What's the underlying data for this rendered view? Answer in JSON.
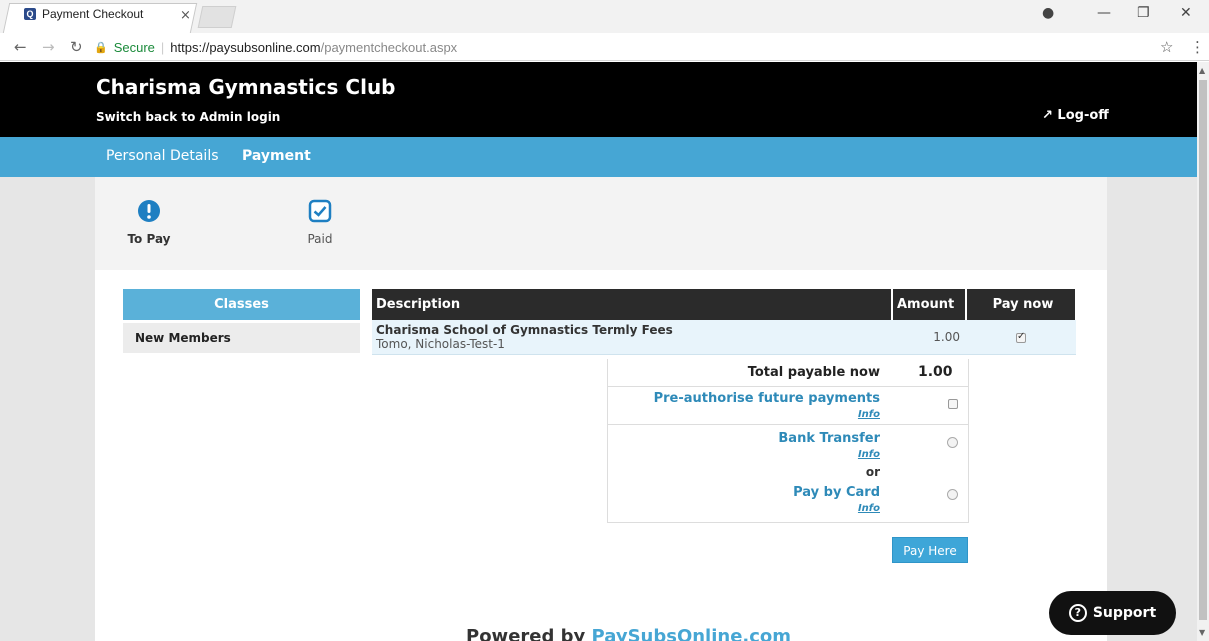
{
  "browser": {
    "tab_title": "Payment Checkout",
    "tab_close": "×",
    "secure_label": "Secure",
    "url_host": "https://paysubsonline.com",
    "url_path": "/paymentcheckout.aspx"
  },
  "header": {
    "club_name": "Charisma Gymnastics Club",
    "switch_link": "Switch back to Admin login",
    "logoff_label": "Log-off"
  },
  "nav": {
    "personal_details": "Personal Details",
    "payment": "Payment"
  },
  "steps": {
    "to_pay": "To Pay",
    "paid": "Paid"
  },
  "classes": {
    "heading": "Classes",
    "items": [
      "New Members"
    ]
  },
  "fees_table": {
    "headers": {
      "description": "Description",
      "amount": "Amount",
      "pay_now": "Pay now"
    },
    "rows": [
      {
        "title": "Charisma School of Gymnastics Termly Fees",
        "subtitle": "Tomo, Nicholas-Test-1",
        "amount": "1.00",
        "pay_now": true
      }
    ]
  },
  "totals": {
    "label": "Total payable now",
    "value": "1.00",
    "preauth_label": "Pre-authorise future payments",
    "bank_transfer_label": "Bank Transfer",
    "or_label": "or",
    "pay_by_card_label": "Pay by Card",
    "info_label": "Info"
  },
  "pay_button": "Pay Here",
  "footer": {
    "powered_prefix": "Powered by ",
    "powered_brand": "PaySubsOnline.com"
  },
  "support": {
    "label": "Support"
  },
  "colors": {
    "nav_blue": "#46a6d4",
    "header_black": "#000000",
    "link_blue": "#2e8ab8"
  }
}
